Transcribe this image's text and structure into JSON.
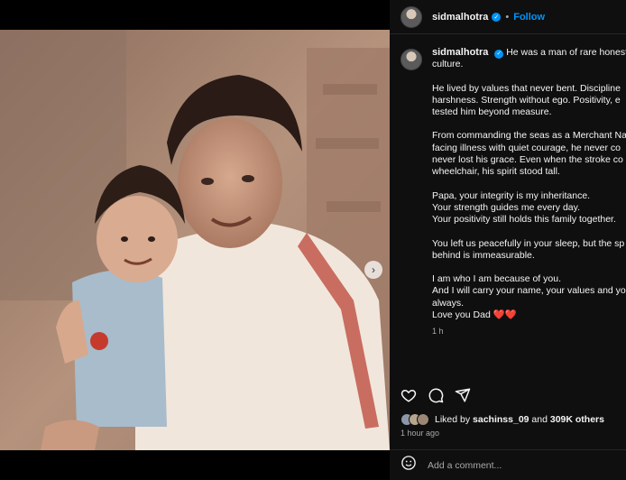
{
  "post": {
    "username": "sidmalhotra",
    "follow_label": "Follow",
    "separator": "•",
    "carousel_next_icon": "chevron-right-icon"
  },
  "caption": {
    "username": "sidmalhotra",
    "lines": [
      "He was a man of rare honesty,",
      "culture.",
      "",
      "He lived by values that never bent. Discipline",
      "harshness. Strength without ego. Positivity, e",
      "tested him beyond measure.",
      "",
      "From commanding the seas as a Merchant Na",
      "facing illness with quiet courage, he never co",
      "never lost his grace. Even when the stroke co",
      "wheelchair, his spirit stood tall.",
      "",
      "Papa, your integrity is my inheritance.",
      "Your strength guides me every day.",
      "Your positivity still holds this family together.",
      "",
      "You left us peacefully in your sleep, but the sp",
      "behind is immeasurable.",
      "",
      "I am who I am because of you.",
      "And I will carry your name, your values and yo",
      "always.",
      "Love you Dad ❤️❤️"
    ],
    "time": "1 h"
  },
  "likes": {
    "prefix": "Liked by ",
    "user": "sachinss_09",
    "middle": " and ",
    "others": "309K others"
  },
  "posted_ago": "1 hour ago",
  "comment": {
    "placeholder": "Add a comment..."
  },
  "colors": {
    "accent": "#0095f6",
    "panel_bg": "#0f0f10",
    "muted_text": "#a8a8a8"
  }
}
